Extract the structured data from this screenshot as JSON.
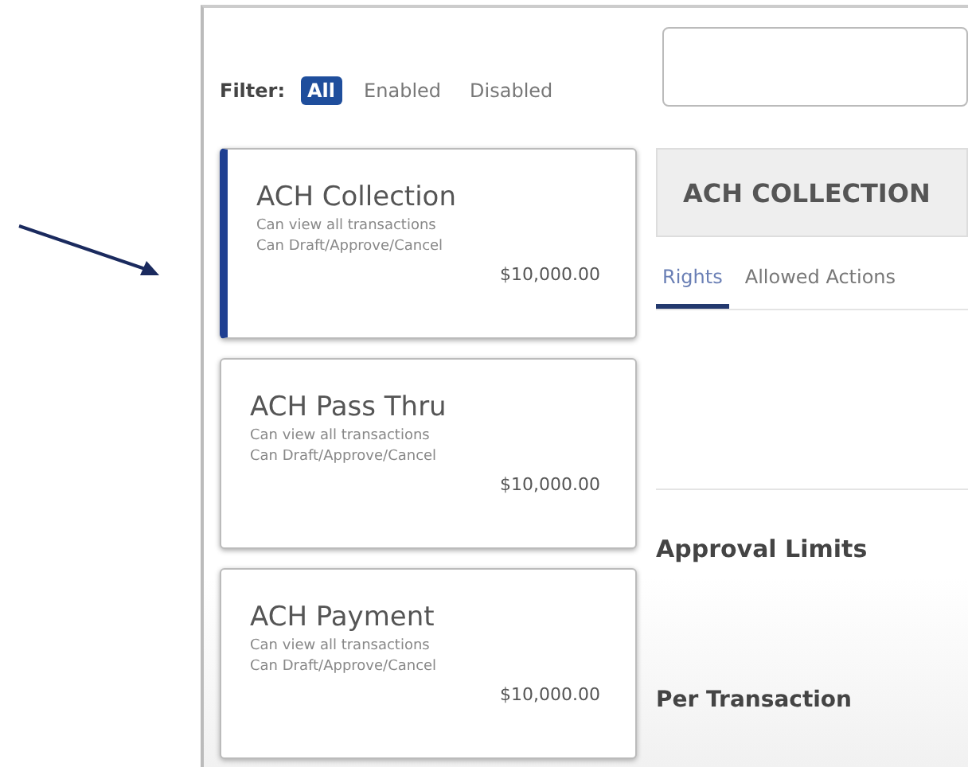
{
  "filter": {
    "label": "Filter:",
    "options": [
      {
        "label": "All",
        "selected": true
      },
      {
        "label": "Enabled",
        "selected": false
      },
      {
        "label": "Disabled",
        "selected": false
      }
    ]
  },
  "cards": [
    {
      "title": "ACH Collection",
      "lines": [
        "Can view all transactions",
        "Can Draft/Approve/Cancel"
      ],
      "amount": "$10,000.00",
      "selected": true
    },
    {
      "title": "ACH Pass Thru",
      "lines": [
        "Can view all transactions",
        "Can Draft/Approve/Cancel"
      ],
      "amount": "$10,000.00",
      "selected": false
    },
    {
      "title": "ACH Payment",
      "lines": [
        "Can view all transactions",
        "Can Draft/Approve/Cancel"
      ],
      "amount": "$10,000.00",
      "selected": false
    }
  ],
  "detail": {
    "title": "ACH COLLECTION",
    "tabs": [
      {
        "label": "Rights",
        "selected": true
      },
      {
        "label": "Allowed Actions",
        "selected": false
      }
    ],
    "sections": [
      "Approval Limits",
      "Per Transaction"
    ]
  }
}
